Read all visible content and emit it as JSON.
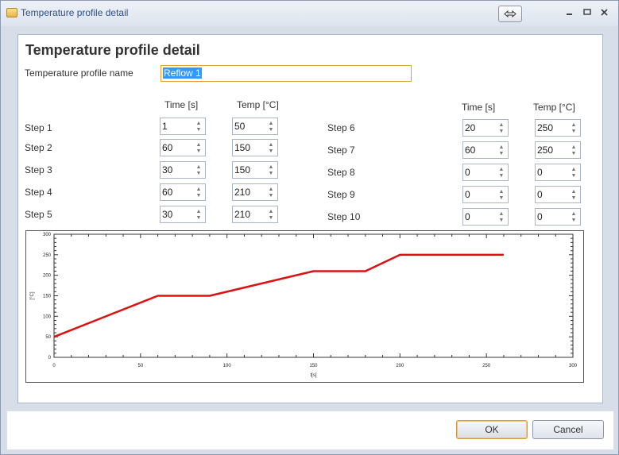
{
  "window": {
    "title": "Temperature profile detail"
  },
  "form": {
    "heading": "Temperature profile detail",
    "name_label": "Temperature profile name",
    "name_value": "Reflow 1",
    "col_time": "Time [s]",
    "col_temp": "Temp [°C]",
    "steps": [
      {
        "label": "Step 1",
        "time": "1",
        "temp": "50"
      },
      {
        "label": "Step 2",
        "time": "60",
        "temp": "150"
      },
      {
        "label": "Step 3",
        "time": "30",
        "temp": "150"
      },
      {
        "label": "Step 4",
        "time": "60",
        "temp": "210"
      },
      {
        "label": "Step 5",
        "time": "30",
        "temp": "210"
      },
      {
        "label": "Step 6",
        "time": "20",
        "temp": "250"
      },
      {
        "label": "Step 7",
        "time": "60",
        "temp": "250"
      },
      {
        "label": "Step 8",
        "time": "0",
        "temp": "0"
      },
      {
        "label": "Step 9",
        "time": "0",
        "temp": "0"
      },
      {
        "label": "Step 10",
        "time": "0",
        "temp": "0"
      }
    ]
  },
  "chart_data": {
    "type": "line",
    "xlabel": "t[s]",
    "ylabel": "[°C]",
    "xlim": [
      0,
      300
    ],
    "ylim": [
      0,
      300
    ],
    "xticks": [
      "0",
      "50",
      "100",
      "150",
      "200",
      "250",
      "300"
    ],
    "yticks": [
      "0",
      "50",
      "100",
      "150",
      "200",
      "250",
      "300"
    ],
    "series": [
      {
        "color": "#dd1111",
        "x": [
          0,
          60,
          90,
          150,
          180,
          200,
          260
        ],
        "y": [
          50,
          150,
          150,
          210,
          210,
          250,
          250
        ]
      }
    ],
    "grid": false
  },
  "buttons": {
    "ok": "OK",
    "cancel": "Cancel"
  }
}
